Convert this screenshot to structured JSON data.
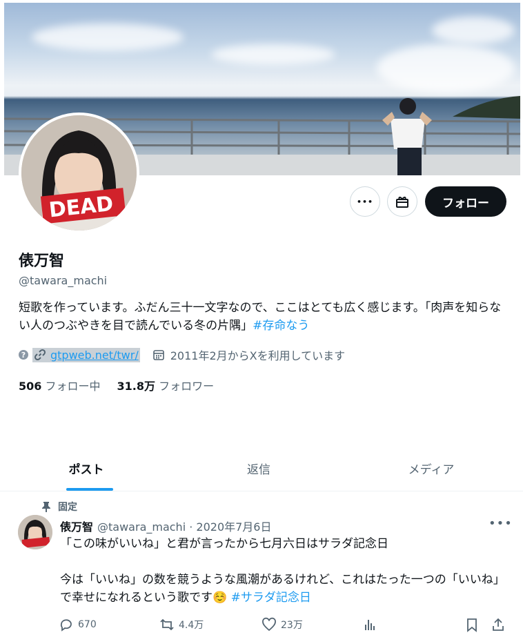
{
  "profile": {
    "name": "俵万智",
    "handle": "@tawara_machi",
    "bio_text": "短歌を作っています。ふだん三十一文字なので、ここはとても広く感じます。「肉声を知らない人のつぶやきを目で読んでいる冬の片隅」",
    "bio_hashtag": "#存命なう",
    "website": "gtpweb.net/twr/",
    "joined": "2011年2月からXを利用しています",
    "avatar_overlay_text": "DEAD"
  },
  "buttons": {
    "more_label": "•••",
    "follow_label": "フォロー"
  },
  "stats": {
    "following_count": "506",
    "following_label": "フォロー中",
    "followers_count": "31.8万",
    "followers_label": "フォロワー"
  },
  "tabs": [
    {
      "label": "ポスト",
      "active": true
    },
    {
      "label": "返信",
      "active": false
    },
    {
      "label": "メディア",
      "active": false
    }
  ],
  "post": {
    "pinned_label": "固定",
    "author_name": "俵万智",
    "author_meta": "@tawara_machi · 2020年7月6日",
    "line1": "「この味がいいね」と君が言ったから七月六日はサラダ記念日",
    "line2": "今は「いいね」の数を競うような風潮があるけれど、これはたった一つの「いいね」で幸せになれるという歌です",
    "emoji": "☺️",
    "hashtag": "#サラダ記念日",
    "replies": "670",
    "reposts": "4.4万",
    "likes": "23万"
  },
  "colors": {
    "accent": "#1d9bf0",
    "text": "#0f1419",
    "secondary": "#536471",
    "follow_bg": "#0f1419"
  }
}
